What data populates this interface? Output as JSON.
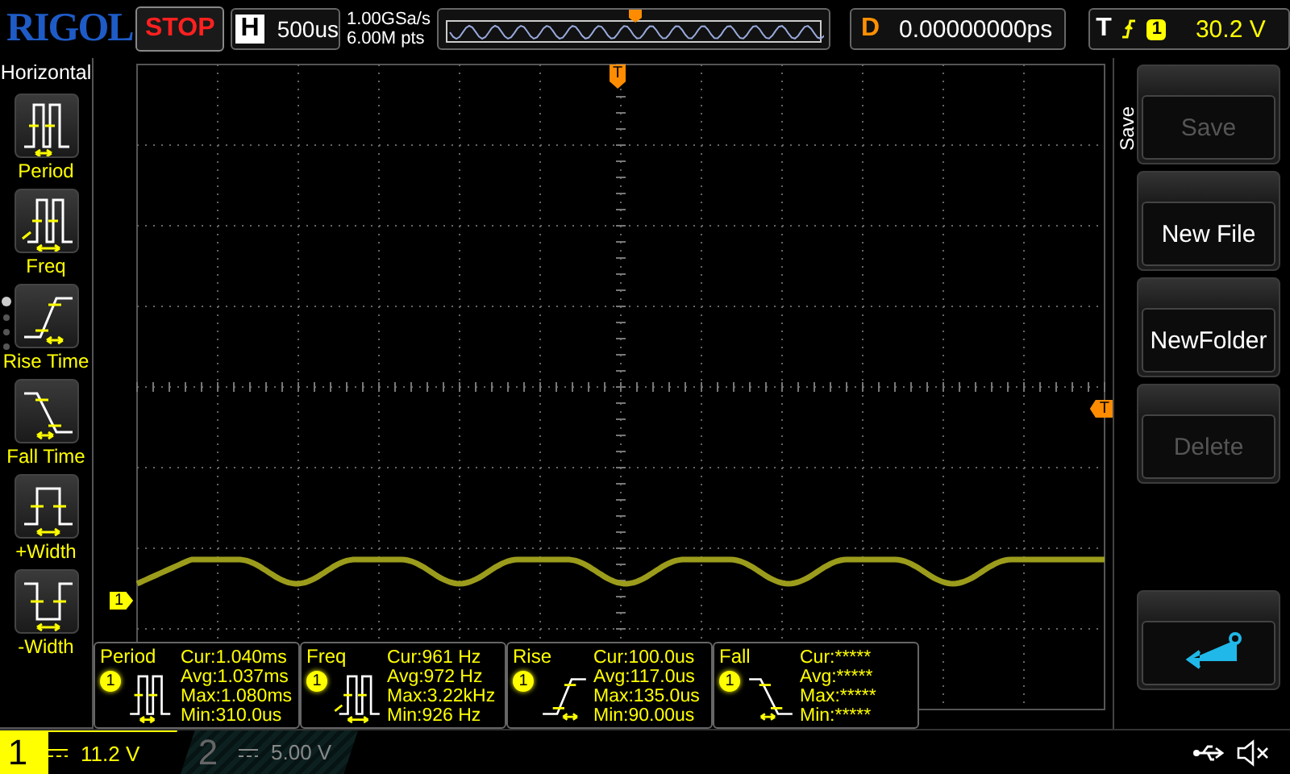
{
  "top_bar": {
    "brand": "RIGOL",
    "run_state": "STOP",
    "timebase": {
      "label": "H",
      "value": "500us"
    },
    "sample": {
      "rate": "1.00GSa/s",
      "depth": "6.00M pts"
    },
    "delay": {
      "label": "D",
      "value": "0.00000000ps"
    },
    "trigger": {
      "label": "T",
      "channel": "1",
      "level": "30.2 V"
    }
  },
  "left_menu": {
    "title": "Horizontal",
    "pages": [
      {
        "selected": true
      },
      {
        "selected": false
      },
      {
        "selected": false
      },
      {
        "selected": false
      }
    ],
    "items": [
      {
        "label": "Period",
        "kind": "period"
      },
      {
        "label": "Freq",
        "kind": "freq"
      },
      {
        "label": "Rise Time",
        "kind": "rise"
      },
      {
        "label": "Fall Time",
        "kind": "fall"
      },
      {
        "label": "+Width",
        "kind": "pwidth"
      },
      {
        "label": "-Width",
        "kind": "nwidth"
      }
    ]
  },
  "screen": {
    "trigger_position_marker": "T",
    "trigger_level_marker": "T",
    "channel_marker": "1"
  },
  "measurements": [
    {
      "name": "Period",
      "channel": "1",
      "kind": "period",
      "lines": [
        "Cur:1.040ms",
        "Avg:1.037ms",
        "Max:1.080ms",
        "Min:310.0us"
      ]
    },
    {
      "name": "Freq",
      "channel": "1",
      "kind": "freq",
      "lines": [
        "Cur:961 Hz",
        "Avg:972 Hz",
        "Max:3.22kHz",
        "Min:926 Hz"
      ]
    },
    {
      "name": "Rise",
      "channel": "1",
      "kind": "rise",
      "lines": [
        "Cur:100.0us",
        "Avg:117.0us",
        "Max:135.0us",
        "Min:90.00us"
      ]
    },
    {
      "name": "Fall",
      "channel": "1",
      "kind": "fall",
      "lines": [
        "Cur:*****",
        "Avg:*****",
        "Max:*****",
        "Min:*****"
      ]
    }
  ],
  "right_menu": {
    "title": "Save",
    "items": [
      {
        "kind": "button",
        "label": "Save",
        "disabled": true
      },
      {
        "kind": "button",
        "label": "New File",
        "disabled": false
      },
      {
        "kind": "button",
        "label": "NewFolder",
        "disabled": false
      },
      {
        "kind": "button",
        "label": "Delete",
        "disabled": true
      },
      {
        "kind": "back"
      }
    ]
  },
  "channels": [
    {
      "number": "1",
      "scale": "11.2 V",
      "on": true
    },
    {
      "number": "2",
      "scale": "5.00 V",
      "on": false
    }
  ]
}
